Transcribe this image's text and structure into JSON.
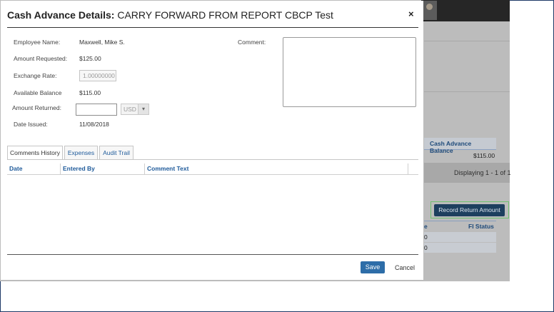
{
  "modal": {
    "title_bold": "Cash Advance Details:",
    "title_rest": "CARRY FORWARD FROM REPORT CBCP Test",
    "close": "×",
    "fields": {
      "employee_name_label": "Employee Name:",
      "employee_name": "Maxwell, Mike S.",
      "amount_requested_label": "Amount Requested:",
      "amount_requested": "$125.00",
      "exchange_rate_label": "Exchange Rate:",
      "exchange_rate": "1.00000000",
      "available_balance_label": "Available Balance",
      "available_balance": "$115.00",
      "amount_returned_label": "Amount Returned:",
      "amount_returned": "",
      "currency": "USD",
      "date_issued_label": "Date Issued:",
      "date_issued": "11/08/2018",
      "comment_label": "Comment:",
      "comment": ""
    },
    "tabs": [
      "Comments History",
      "Expenses",
      "Audit Trail"
    ],
    "grid_columns": [
      "Date",
      "Entered By",
      "Comment Text"
    ],
    "save_label": "Save",
    "cancel_label": "Cancel"
  },
  "background": {
    "balance_header": "Cash Advance Balance",
    "balance_value": "$115.00",
    "pager_text": "Displaying 1 - 1 of 1",
    "record_button": "Record Return Amount",
    "col_partial": "e",
    "fi_status_header": "FI Status",
    "row1_partial": "0",
    "row2_partial": "0"
  },
  "colors": {
    "accent": "#2d6da8",
    "link": "#1e5a9a",
    "overlay": "#bcbcbc"
  }
}
